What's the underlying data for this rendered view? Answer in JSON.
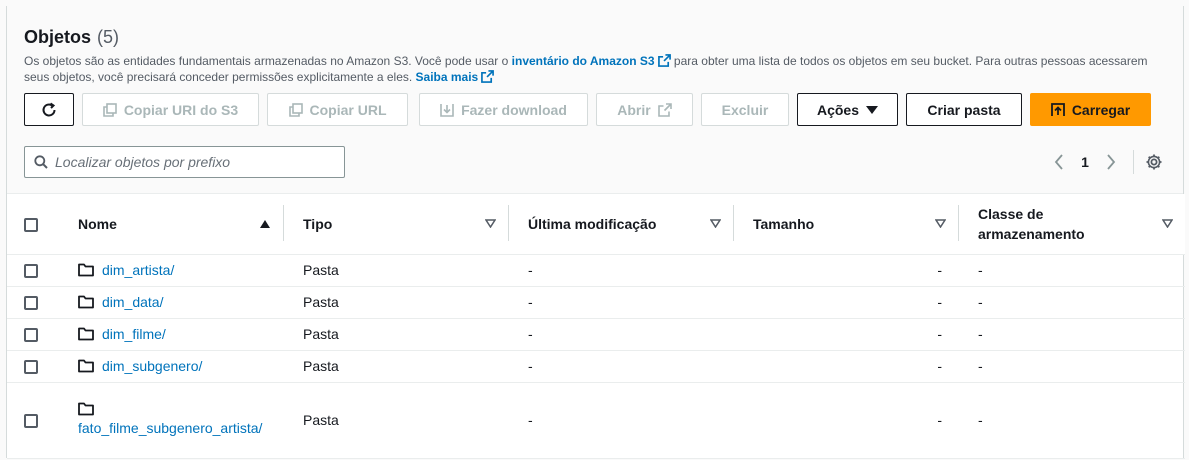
{
  "header": {
    "title": "Objetos",
    "count": "(5)",
    "description_part1": "Os objetos são as entidades fundamentais armazenadas no Amazon S3. Você pode usar o ",
    "inventory_link": "inventário do Amazon S3",
    "description_part2": " para obter uma lista de todos os objetos em seu bucket. Para outras pessoas acessarem seus objetos, você precisará conceder permissões explicitamente a eles. ",
    "learn_more_link": "Saiba mais"
  },
  "toolbar": {
    "copy_s3_uri": "Copiar URI do S3",
    "copy_url": "Copiar URL",
    "download": "Fazer download",
    "open": "Abrir",
    "delete": "Excluir",
    "actions": "Ações",
    "create_folder": "Criar pasta",
    "upload": "Carregar"
  },
  "search": {
    "placeholder": "Localizar objetos por prefixo"
  },
  "pagination": {
    "current_page": "1"
  },
  "table": {
    "columns": {
      "name": "Nome",
      "type": "Tipo",
      "last_modified": "Última modificação",
      "size": "Tamanho",
      "storage_class_line1": "Classe de",
      "storage_class_line2": "armazenamento"
    },
    "rows": [
      {
        "name": "dim_artista/",
        "type": "Pasta",
        "last_modified": "-",
        "size": "-",
        "storage_class": "-"
      },
      {
        "name": "dim_data/",
        "type": "Pasta",
        "last_modified": "-",
        "size": "-",
        "storage_class": "-"
      },
      {
        "name": "dim_filme/",
        "type": "Pasta",
        "last_modified": "-",
        "size": "-",
        "storage_class": "-"
      },
      {
        "name": "dim_subgenero/",
        "type": "Pasta",
        "last_modified": "-",
        "size": "-",
        "storage_class": "-"
      },
      {
        "name": "fato_filme_subgenero_artista/",
        "type": "Pasta",
        "last_modified": "-",
        "size": "-",
        "storage_class": "-"
      }
    ]
  },
  "icons": {
    "refresh": "refresh-icon",
    "copy": "copy-icon",
    "download": "download-icon",
    "external": "external-link-icon",
    "caret_down": "caret-down-icon",
    "upload": "upload-icon",
    "search": "search-icon",
    "chevron_left": "chevron-left-icon",
    "chevron_right": "chevron-right-icon",
    "settings": "gear-icon",
    "folder": "folder-icon",
    "sort_ascending": "sort-ascending-icon",
    "sort": "sort-icon"
  },
  "colors": {
    "primary": "#ff9900",
    "link": "#0073bb",
    "text": "#16191f",
    "muted": "#545b64",
    "disabled": "#aab7b8"
  }
}
